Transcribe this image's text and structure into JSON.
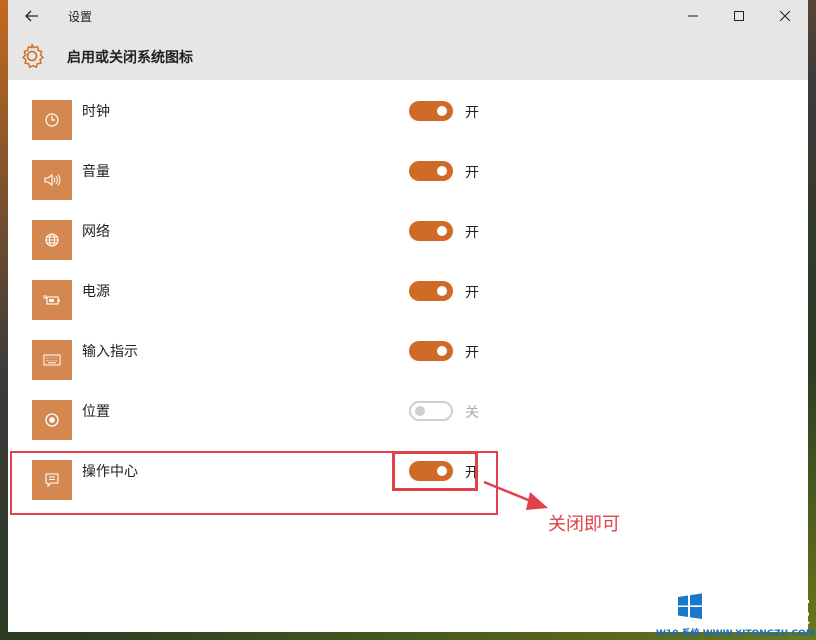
{
  "window": {
    "title": "设置",
    "header_title": "启用或关闭系统图标"
  },
  "items": [
    {
      "label": "时钟",
      "state": "开",
      "on": true,
      "icon": "clock-icon"
    },
    {
      "label": "音量",
      "state": "开",
      "on": true,
      "icon": "volume-icon"
    },
    {
      "label": "网络",
      "state": "开",
      "on": true,
      "icon": "globe-icon"
    },
    {
      "label": "电源",
      "state": "开",
      "on": true,
      "icon": "battery-icon"
    },
    {
      "label": "输入指示",
      "state": "开",
      "on": true,
      "icon": "keyboard-icon"
    },
    {
      "label": "位置",
      "state": "关",
      "on": false,
      "icon": "location-icon"
    },
    {
      "label": "操作中心",
      "state": "开",
      "on": true,
      "icon": "action-center-icon"
    }
  ],
  "annotation": {
    "text": "关闭即可",
    "color": "#e0414a"
  },
  "watermark": {
    "text": "系统族",
    "sub": "W10 系统 WWW.XITONGZU.COM"
  },
  "colors": {
    "accent": "#d06a27",
    "icon_tile": "#d4874e"
  }
}
